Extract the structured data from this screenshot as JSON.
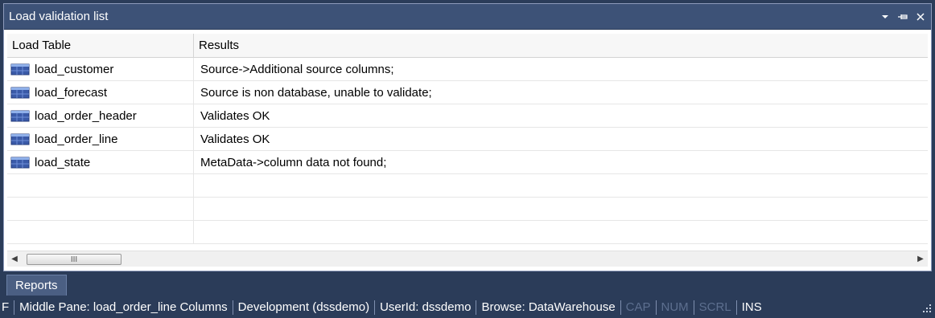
{
  "panel": {
    "title": "Load validation list",
    "buttons": {
      "dropdown_icon": "chevron-down-icon",
      "pin_icon": "pin-icon",
      "close_icon": "close-icon"
    }
  },
  "table": {
    "columns": [
      "Load Table",
      "Results"
    ],
    "rows": [
      {
        "icon": "table-icon",
        "name": "load_customer",
        "result": "Source->Additional source columns;"
      },
      {
        "icon": "table-icon",
        "name": "load_forecast",
        "result": "Source is non database, unable to validate;"
      },
      {
        "icon": "table-icon",
        "name": "load_order_header",
        "result": "Validates OK"
      },
      {
        "icon": "table-icon",
        "name": "load_order_line",
        "result": "Validates OK"
      },
      {
        "icon": "table-icon",
        "name": "load_state",
        "result": "MetaData->column data not found;"
      }
    ]
  },
  "scrollbar": {
    "thumb_glyph": "III"
  },
  "tabs": {
    "reports": "Reports"
  },
  "status": {
    "f": "F",
    "middle_pane": "Middle Pane: load_order_line Columns",
    "environment": "Development (dssdemo)",
    "user": "UserId: dssdemo",
    "browse": "Browse: DataWarehouse",
    "cap": "CAP",
    "num": "NUM",
    "scrl": "SCRL",
    "ins": "INS"
  },
  "colors": {
    "titlebar": "#3d5277",
    "background": "#2b3c59",
    "tab": "#4b5f83",
    "dim_status": "#5d6f8f"
  }
}
